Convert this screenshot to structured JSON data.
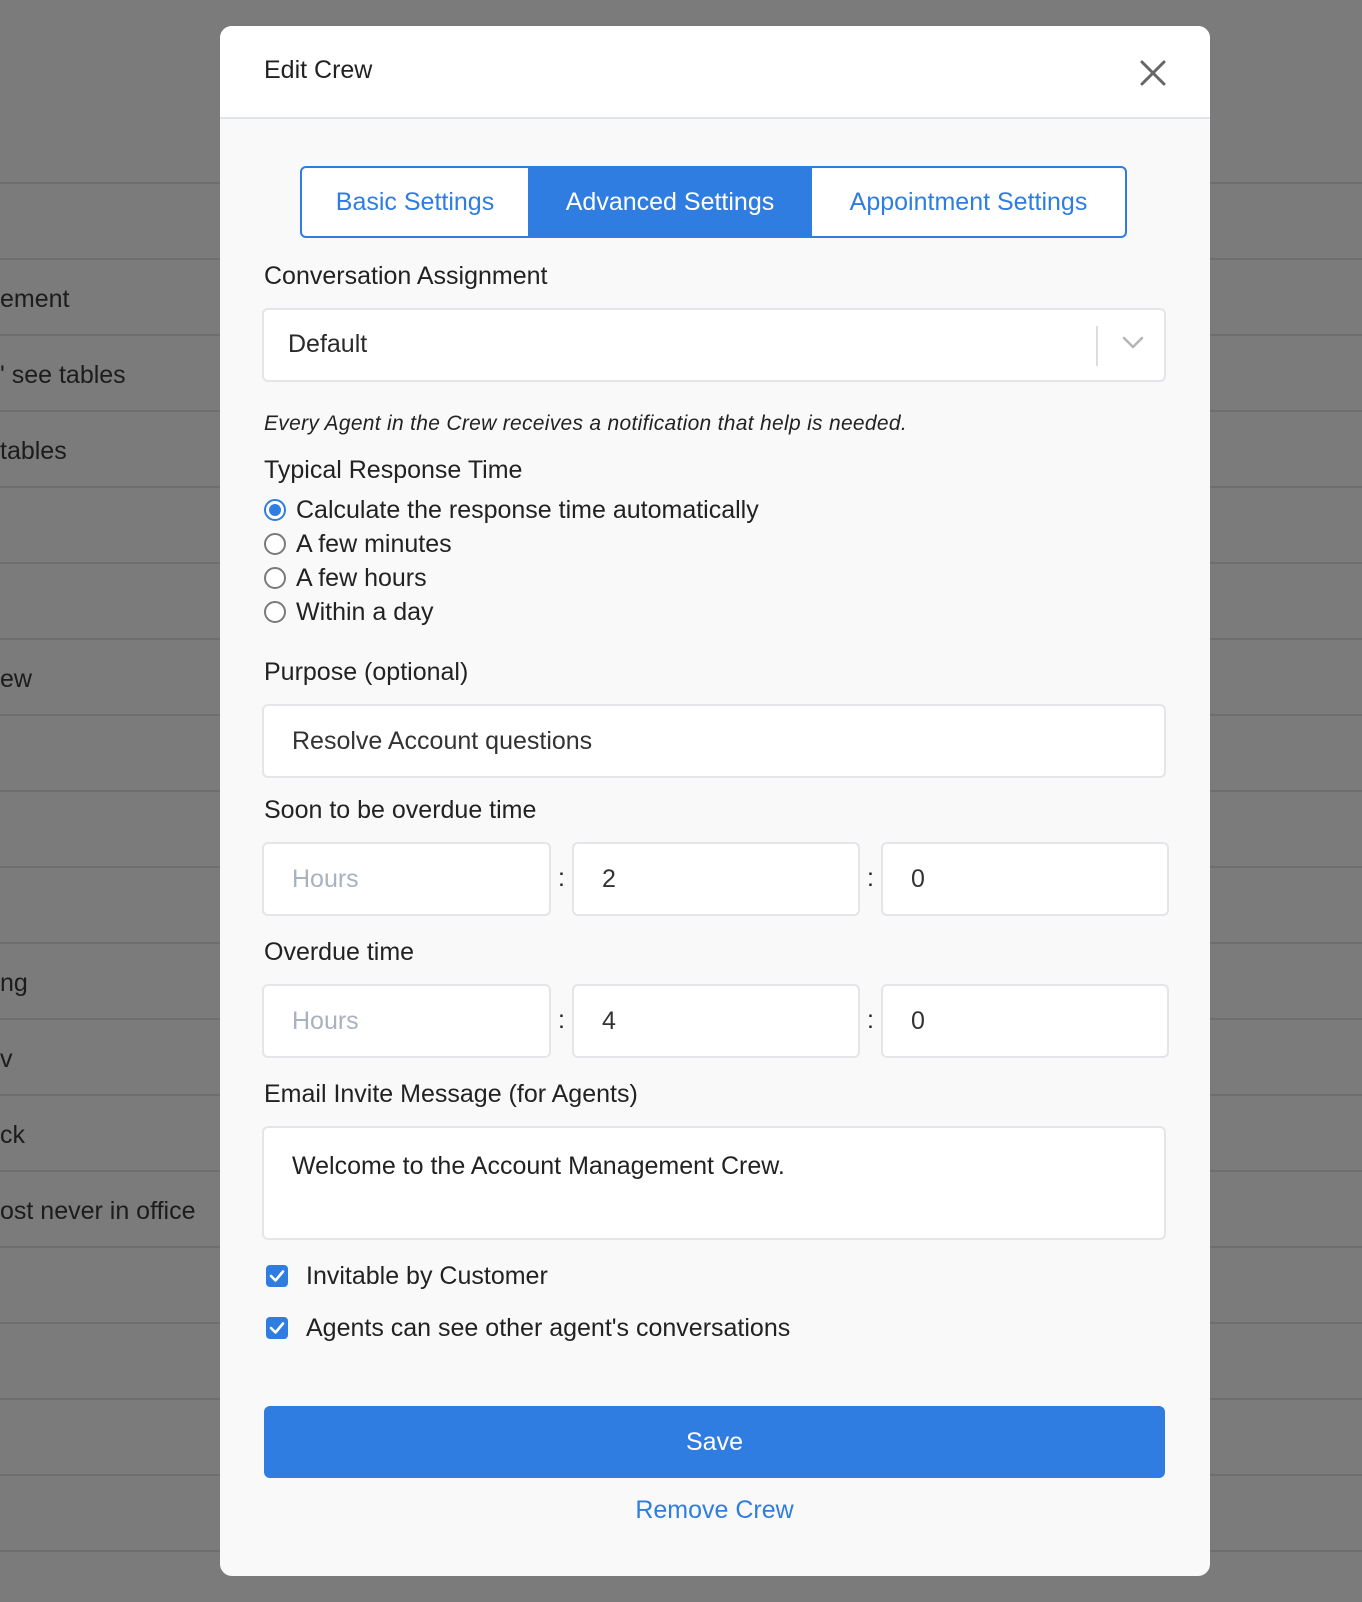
{
  "background": {
    "row_texts": [
      "ement",
      "' see tables",
      "tables",
      "ew",
      "ng",
      "v",
      "ck",
      "ost never in office"
    ]
  },
  "modal": {
    "title": "Edit Crew",
    "tabs": [
      {
        "label": "Basic Settings",
        "active": false
      },
      {
        "label": "Advanced Settings",
        "active": true
      },
      {
        "label": "Appointment Settings",
        "active": false
      }
    ],
    "conversation_assignment": {
      "label": "Conversation Assignment",
      "selected": "Default",
      "hint": "Every Agent in the Crew receives a notification that help is needed."
    },
    "response_time": {
      "label": "Typical Response Time",
      "options": [
        {
          "label": "Calculate the response time automatically",
          "selected": true
        },
        {
          "label": "A few minutes",
          "selected": false
        },
        {
          "label": "A few hours",
          "selected": false
        },
        {
          "label": "Within a day",
          "selected": false
        }
      ]
    },
    "purpose": {
      "label": "Purpose (optional)",
      "value": "Resolve Account questions"
    },
    "soon_overdue": {
      "label": "Soon to be overdue time",
      "hours_placeholder": "Hours",
      "minutes": "2",
      "seconds": "0"
    },
    "overdue": {
      "label": "Overdue time",
      "hours_placeholder": "Hours",
      "minutes": "4",
      "seconds": "0"
    },
    "colon": ":",
    "email_invite": {
      "label": "Email Invite Message (for Agents)",
      "value": "Welcome to the Account Management Crew."
    },
    "checkboxes": [
      {
        "label": "Invitable by Customer",
        "checked": true
      },
      {
        "label": "Agents can see other agent's conversations",
        "checked": true
      }
    ],
    "save_label": "Save",
    "remove_label": "Remove Crew"
  },
  "colors": {
    "accent": "#2f7de1",
    "overlay": "#7b7b7b"
  }
}
